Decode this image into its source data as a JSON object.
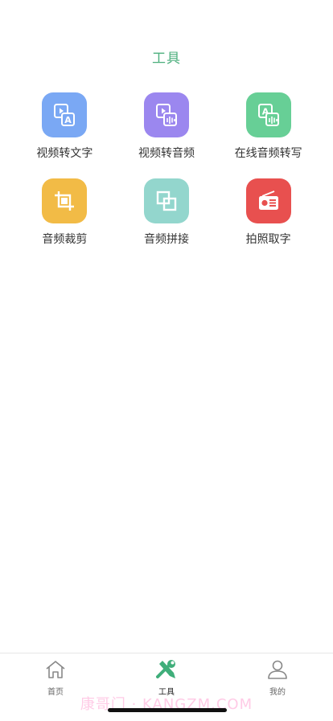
{
  "page": {
    "title": "工具"
  },
  "colors": {
    "accent": "#4caf7d",
    "video_to_text": "#7aa8f4",
    "video_to_audio": "#9b87ef",
    "online_transcribe": "#67cf96",
    "audio_trim": "#f2bb46",
    "audio_splice": "#93d6cd",
    "photo_ocr": "#e8504f"
  },
  "tools": [
    {
      "label": "视频转文字",
      "icon": "video-to-text-icon"
    },
    {
      "label": "视频转音频",
      "icon": "video-to-audio-icon"
    },
    {
      "label": "在线音频转写",
      "icon": "audio-transcribe-icon"
    },
    {
      "label": "音频裁剪",
      "icon": "crop-icon"
    },
    {
      "label": "音频拼接",
      "icon": "splice-icon"
    },
    {
      "label": "拍照取字",
      "icon": "radio-icon"
    }
  ],
  "tabbar": {
    "home": "首页",
    "tools": "工具",
    "mine": "我的"
  },
  "watermark": "康哥门 · KANGZM.COM"
}
